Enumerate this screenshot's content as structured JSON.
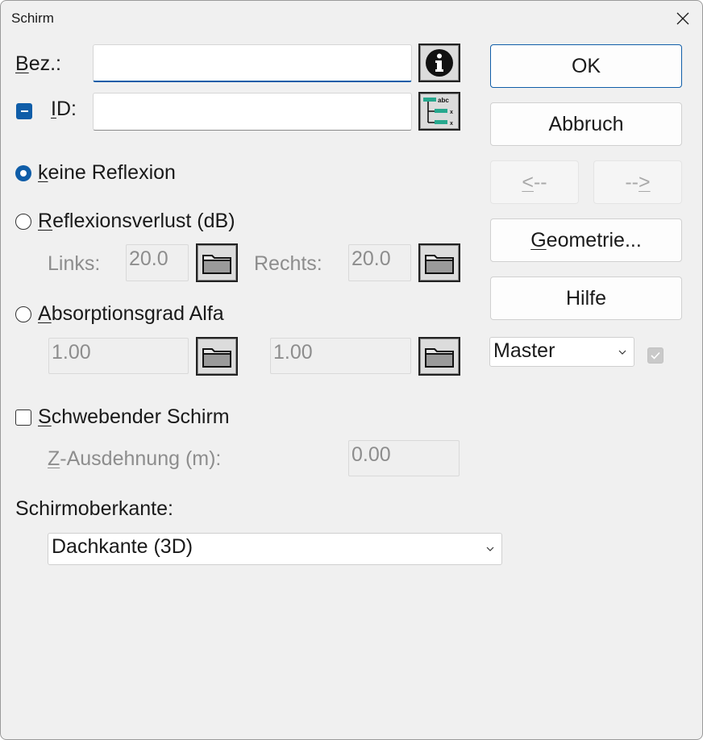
{
  "window": {
    "title": "Schirm"
  },
  "bez": {
    "label_u": "B",
    "label_rest": "ez.:",
    "value": ""
  },
  "id": {
    "label_u": "I",
    "label_rest": "D:",
    "value": ""
  },
  "reflection": {
    "none_u": "k",
    "none_rest": "eine Reflexion",
    "loss_u": "R",
    "loss_rest": "eflexionsverlust (dB)",
    "left_label": "Links:",
    "left_value": "20.0",
    "right_label": "Rechts:",
    "right_value": "20.0",
    "absorption_u": "A",
    "absorption_rest": "bsorptionsgrad Alfa",
    "abs_left_value": "1.00",
    "abs_right_value": "1.00"
  },
  "floating": {
    "label_u": "S",
    "label_rest": "chwebender Schirm",
    "z_label_u": "Z",
    "z_label_rest": "-Ausdehnung (m):",
    "z_value": "0.00"
  },
  "top_edge": {
    "label": "Schirmoberkante:",
    "selected": "Dachkante (3D)"
  },
  "buttons": {
    "ok": "OK",
    "cancel": "Abbruch",
    "prev_u": "<",
    "prev_rest": "--",
    "next_pre": "--",
    "next_u": ">",
    "geometry_u": "G",
    "geometry_rest": "eometrie...",
    "help": "Hilfe"
  },
  "master": {
    "selected": "Master"
  },
  "colors": {
    "accent": "#0f5da8",
    "dialog_bg": "#f0f0f0"
  }
}
